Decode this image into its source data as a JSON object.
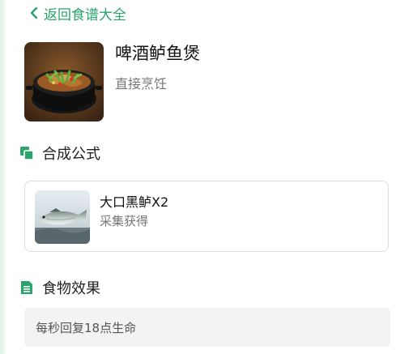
{
  "nav": {
    "back_label": "返回食谱大全",
    "back_icon": "chevron-left-icon",
    "accent_color": "#2aa46a"
  },
  "recipe": {
    "name": "啤酒鲈鱼煲",
    "method": "直接烹饪",
    "image": "beer-perch-claypot-dish"
  },
  "formula": {
    "heading": "合成公式",
    "icon": "layers-icon",
    "ingredients": [
      {
        "name": "大口黑鲈X2",
        "source": "采集获得",
        "image": "largemouth-bass-fish"
      }
    ]
  },
  "effects": {
    "heading": "食物效果",
    "icon": "document-icon",
    "text": "每秒回复18点生命"
  }
}
